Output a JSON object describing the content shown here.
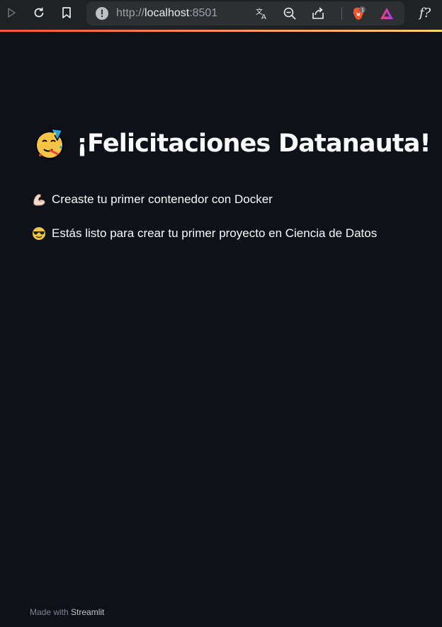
{
  "browser": {
    "url_scheme": "http://",
    "url_host": "localhost",
    "url_port": ":8501",
    "extension_badge": "1",
    "fx_label": "f?"
  },
  "main": {
    "title": "¡Felicitaciones Datanauta!",
    "title_icon": "partying-face-icon",
    "lines": [
      {
        "icon": "flexed-biceps-icon",
        "text": "Creaste tu primer contenedor con Docker"
      },
      {
        "icon": "smiling-face-with-sunglasses-icon",
        "text": "Estás listo para crear tu primer proyecto en Ciencia de Datos"
      }
    ]
  },
  "footer": {
    "prefix": "Made with ",
    "brand": "Streamlit"
  },
  "colors": {
    "background": "#0e1117",
    "text": "#fafafa",
    "accent": "#ff4b4b"
  }
}
